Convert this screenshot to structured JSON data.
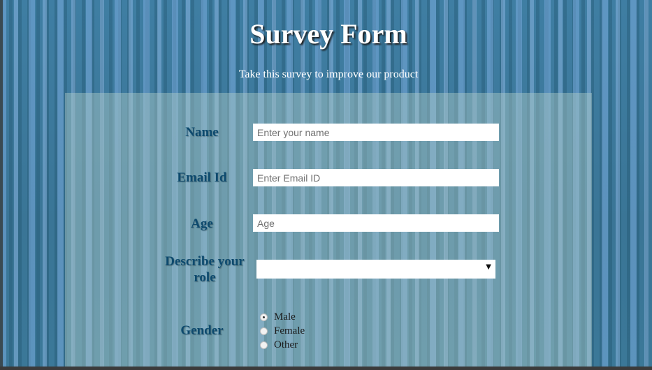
{
  "page": {
    "title": "Survey Form",
    "subtitle": "Take this survey to improve our product"
  },
  "form": {
    "name": {
      "label": "Name",
      "placeholder": "Enter your name"
    },
    "email": {
      "label": "Email Id",
      "placeholder": "Enter Email ID"
    },
    "age": {
      "label": "Age",
      "placeholder": "Age"
    },
    "role": {
      "label": "Describe your role",
      "selected": ""
    },
    "gender": {
      "label": "Gender",
      "options": [
        "Male",
        "Female",
        "Other"
      ],
      "selected": "Male"
    }
  },
  "colors": {
    "label": "#0d4a6e",
    "title": "#ffffff",
    "panel": "rgba(175,205,200,0.45)"
  }
}
